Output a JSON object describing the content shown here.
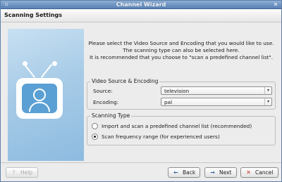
{
  "window": {
    "title": "Channel Wizard",
    "menu_icon": "window-menu-icon",
    "close_glyph": "✕"
  },
  "header": {
    "title": "Scanning Settings"
  },
  "intro": {
    "line1": "Please select the Video Source and Encoding that you would like to use.",
    "line2": "The scanning type can also be selected here.",
    "line3": "It is recommended that you choose to \"scan a predefined channel list\"."
  },
  "source_group": {
    "title": "Video Source & Encoding",
    "source_label": "Source:",
    "source_value": "television",
    "encoding_label": "Encoding:",
    "encoding_value": "pal"
  },
  "scan_group": {
    "title": "Scanning Type",
    "options": [
      {
        "label": "Import and scan a predefined channel list (recommended)",
        "selected": false
      },
      {
        "label": "Scan frequency range (for experienced users)",
        "selected": true
      }
    ]
  },
  "buttons": {
    "help": "Help",
    "back": "Back",
    "next": "Next",
    "cancel": "Cancel"
  },
  "colors": {
    "titlebar": "#6e94c3",
    "panel": "#a7cbe7",
    "tv_screen": "#5aa0d4"
  }
}
